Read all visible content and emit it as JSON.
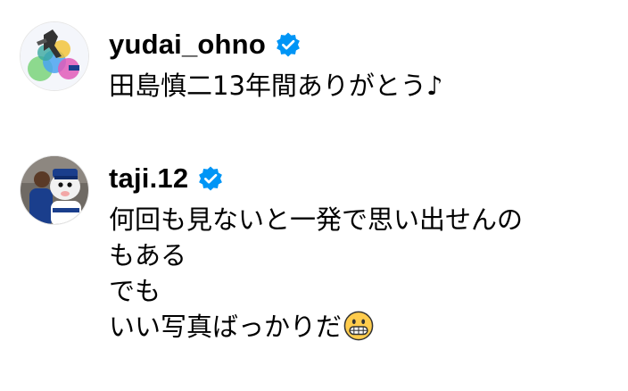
{
  "comments": [
    {
      "username": "yudai_ohno",
      "verified": true,
      "avatar_icon": "baseball-player-avatar-icon",
      "lines": [
        "田島慎二13年間ありがとう♪"
      ]
    },
    {
      "username": "taji.12",
      "verified": true,
      "avatar_icon": "mascot-photo-avatar-icon",
      "lines": [
        "何回も見ないと一発で思い出せんの",
        "もある",
        "でも",
        "いい写真ばっかりだ"
      ],
      "emoji": "grinning-face-emoji"
    }
  ],
  "colors": {
    "verified_badge": "#0095F6",
    "text": "#000000",
    "background": "#FFFFFF"
  }
}
